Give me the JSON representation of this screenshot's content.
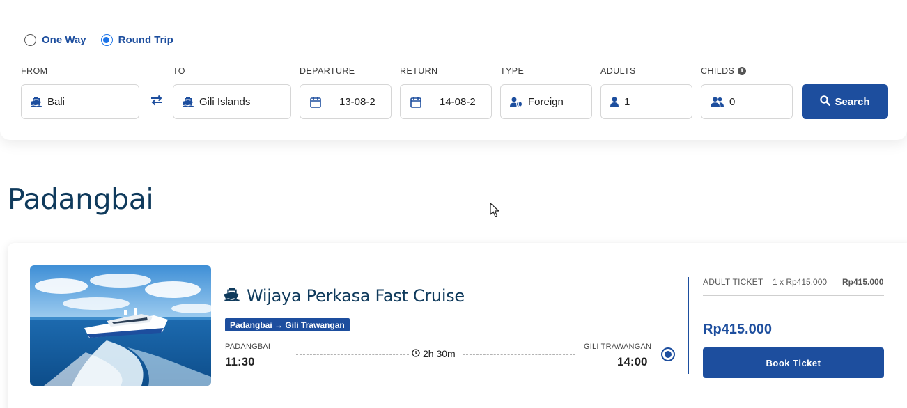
{
  "search": {
    "trip_types": [
      {
        "label": "One Way",
        "selected": false
      },
      {
        "label": "Round Trip",
        "selected": true
      }
    ],
    "from": {
      "label": "FROM",
      "value": "Bali",
      "icon": "ship-icon"
    },
    "to": {
      "label": "TO",
      "value": "Gili Islands",
      "icon": "ship-icon"
    },
    "departure": {
      "label": "DEPARTURE",
      "value": "13-08-2",
      "icon": "calendar-icon"
    },
    "return": {
      "label": "RETURN",
      "value": "14-08-2",
      "icon": "calendar-icon"
    },
    "type": {
      "label": "TYPE",
      "value": "Foreign",
      "icon": "user-globe-icon"
    },
    "adults": {
      "label": "ADULTS",
      "value": "1",
      "icon": "user-icon"
    },
    "childs": {
      "label": "CHILDS",
      "value": "0",
      "icon": "users-icon",
      "info_icon": "info-icon"
    },
    "search_label": "Search",
    "swap_icon": "swap-icon"
  },
  "results": {
    "port_title": "Padangbai",
    "trips": [
      {
        "operator": "Wijaya Perkasa Fast Cruise",
        "route_badge": "Padangbai → Gili Trawangan",
        "departure_port": "PADANGBAI",
        "departure_time": "11:30",
        "arrival_port": "GILI TRAWANGAN",
        "arrival_time": "14:00",
        "duration": "2h 30m",
        "selected": true,
        "ticket_type": "ADULT TICKET",
        "ticket_calc": "1 x Rp415.000",
        "ticket_subtotal": "Rp415.000",
        "total": "Rp415.000",
        "book_label": "Book Ticket"
      }
    ]
  },
  "colors": {
    "brand": "#1d4e9e",
    "title": "#0f3a5c",
    "radio_accent": "#1a73e8"
  }
}
